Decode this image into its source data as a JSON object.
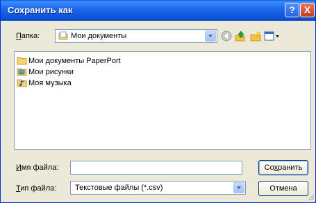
{
  "window": {
    "title": "Сохранить как",
    "help_icon": "?",
    "close_icon": "X"
  },
  "folder": {
    "label_prefix": "",
    "label_accel": "П",
    "label_rest": "апка:",
    "value": "Мои документы"
  },
  "files": [
    {
      "name": "Мои документы PaperPort",
      "icon": "folder-icon"
    },
    {
      "name": "Мои рисунки",
      "icon": "pictures-folder-icon"
    },
    {
      "name": "Моя музыка",
      "icon": "music-folder-icon"
    }
  ],
  "filename": {
    "label_accel": "И",
    "label_rest": "мя файла:",
    "value": ""
  },
  "filetype": {
    "label_accel": "Т",
    "label_rest": "ип файла:",
    "value": "Текстовые файлы (*.csv)"
  },
  "buttons": {
    "save_prefix": "Со",
    "save_accel": "х",
    "save_rest": "ранить",
    "cancel": "Отмена"
  },
  "colors": {
    "title_bar": "#0b53d8",
    "dialog_bg": "#ece9d8",
    "field_border": "#7f9db9"
  }
}
